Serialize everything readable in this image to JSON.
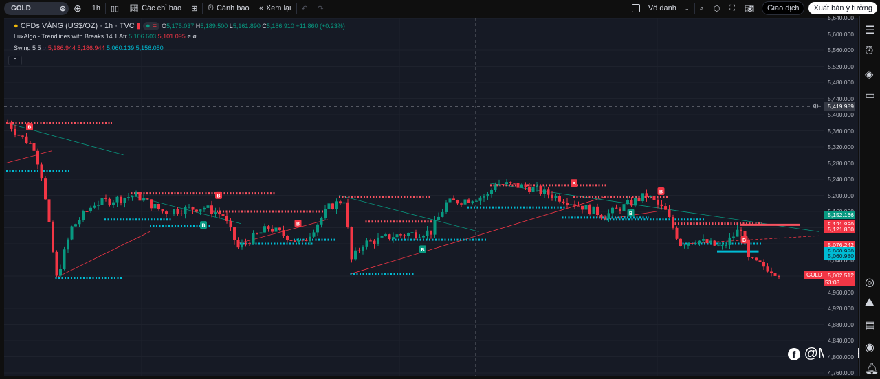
{
  "toolbar": {
    "symbol": "GOLD",
    "interval": "1h",
    "indicators": "Các chỉ báo",
    "alerts": "Cảnh báo",
    "replay": "Xem lại",
    "layout_name": "Vô danh",
    "trade": "Giao dịch",
    "publish": "Xuất bản ý tưởng"
  },
  "legend": {
    "title": "CFDs VÀNG (US$/OZ) · 1h · TVC",
    "o_label": "O",
    "o": "5,175.037",
    "h_label": "H",
    "h": "5,189.500",
    "l_label": "L",
    "l": "5,161.890",
    "c_label": "C",
    "c": "5,186.910",
    "change": "+11.860 (+0.23%)",
    "ind1_name": "LuxAlgo - Trendlines with Breaks 14 1 Atr",
    "ind1_v1": "5,106.603",
    "ind1_v2": "5,101.095",
    "ind1_v3": "ø ø",
    "ind2_name": "Swing 5 5",
    "ind2_v1": "5,186.944",
    "ind2_v2": "5,186.944",
    "ind2_v3": "5,060.139",
    "ind2_v4": "5,156.050"
  },
  "axis": {
    "ticks": [
      "5,640.000",
      "5,600.000",
      "5,560.000",
      "5,520.000",
      "5,480.000",
      "5,440.000",
      "5,400.000",
      "5,360.000",
      "5,320.000",
      "5,280.000",
      "5,240.000",
      "5,200.000",
      "5,160.000",
      "5,120.000",
      "5,080.000",
      "5,040.000",
      "5,000.000",
      "4,960.000",
      "4,920.000",
      "4,880.000",
      "4,840.000",
      "4,800.000",
      "4,760.000"
    ],
    "crosshair_price": "5,419.989",
    "labels": [
      {
        "text": "5,152.166",
        "price": 5152,
        "color": "#089981"
      },
      {
        "text": "5,121.860",
        "price": 5127,
        "color": "#f23645"
      },
      {
        "text": "5,121.860",
        "price": 5116,
        "color": "#f23645"
      },
      {
        "text": "5,076.242",
        "price": 5076,
        "color": "#f23645"
      },
      {
        "text": "5,060.980",
        "price": 5061,
        "color": "#00bcd4"
      },
      {
        "text": "5,060.980",
        "price": 5050,
        "color": "#00bcd4"
      }
    ],
    "last_symbol": "GOLD",
    "last_price": "5,002.512",
    "countdown": "53:03"
  },
  "colors": {
    "up": "#089981",
    "down": "#f23645",
    "support": "#00bcd4",
    "resist": "#f7525f"
  },
  "chart_data": {
    "type": "candlestick",
    "price_range": [
      4760,
      5640
    ],
    "candle_count": 205,
    "path": [
      [
        0,
        5380
      ],
      [
        3,
        5350
      ],
      [
        7,
        5320
      ],
      [
        9,
        5250
      ],
      [
        13,
        4995
      ],
      [
        17,
        5120
      ],
      [
        23,
        5180
      ],
      [
        34,
        5200
      ],
      [
        41,
        5160
      ],
      [
        52,
        5170
      ],
      [
        57,
        5150
      ],
      [
        61,
        5070
      ],
      [
        69,
        5120
      ],
      [
        78,
        5080
      ],
      [
        85,
        5170
      ],
      [
        89,
        5190
      ],
      [
        91,
        5040
      ],
      [
        94,
        5080
      ],
      [
        102,
        5100
      ],
      [
        112,
        5110
      ],
      [
        116,
        5180
      ],
      [
        127,
        5200
      ],
      [
        129,
        5230
      ],
      [
        138,
        5220
      ],
      [
        150,
        5180
      ],
      [
        158,
        5150
      ],
      [
        169,
        5200
      ],
      [
        174,
        5160
      ],
      [
        178,
        5080
      ],
      [
        182,
        5090
      ],
      [
        189,
        5070
      ],
      [
        194,
        5120
      ],
      [
        196,
        5040
      ],
      [
        201,
        5020
      ],
      [
        205,
        5002
      ]
    ],
    "resistance": [
      [
        0,
        28,
        5380
      ],
      [
        33,
        71,
        5205
      ],
      [
        54,
        85,
        5160
      ],
      [
        88,
        112,
        5195
      ],
      [
        95,
        113,
        5135
      ],
      [
        128,
        159,
        5225
      ],
      [
        150,
        175,
        5195
      ],
      [
        176,
        200,
        5130
      ]
    ],
    "support": [
      [
        0,
        17,
        5260
      ],
      [
        13,
        31,
        4995
      ],
      [
        26,
        44,
        5140
      ],
      [
        38,
        54,
        5125
      ],
      [
        61,
        81,
        5080
      ],
      [
        76,
        87,
        5090
      ],
      [
        91,
        108,
        5005
      ],
      [
        102,
        127,
        5090
      ],
      [
        122,
        148,
        5170
      ],
      [
        147,
        170,
        5145
      ],
      [
        158,
        185,
        5140
      ],
      [
        178,
        200,
        5080
      ]
    ],
    "break_markers": [
      [
        6,
        "B",
        1
      ],
      [
        52,
        "B",
        0
      ],
      [
        56,
        "B",
        1
      ],
      [
        77,
        "B",
        1
      ],
      [
        110,
        "B",
        0
      ],
      [
        150,
        "B",
        1
      ],
      [
        165,
        "B",
        0
      ],
      [
        173,
        "B",
        1
      ],
      [
        195,
        "B",
        1
      ]
    ]
  },
  "watermark": "@MarcoK"
}
